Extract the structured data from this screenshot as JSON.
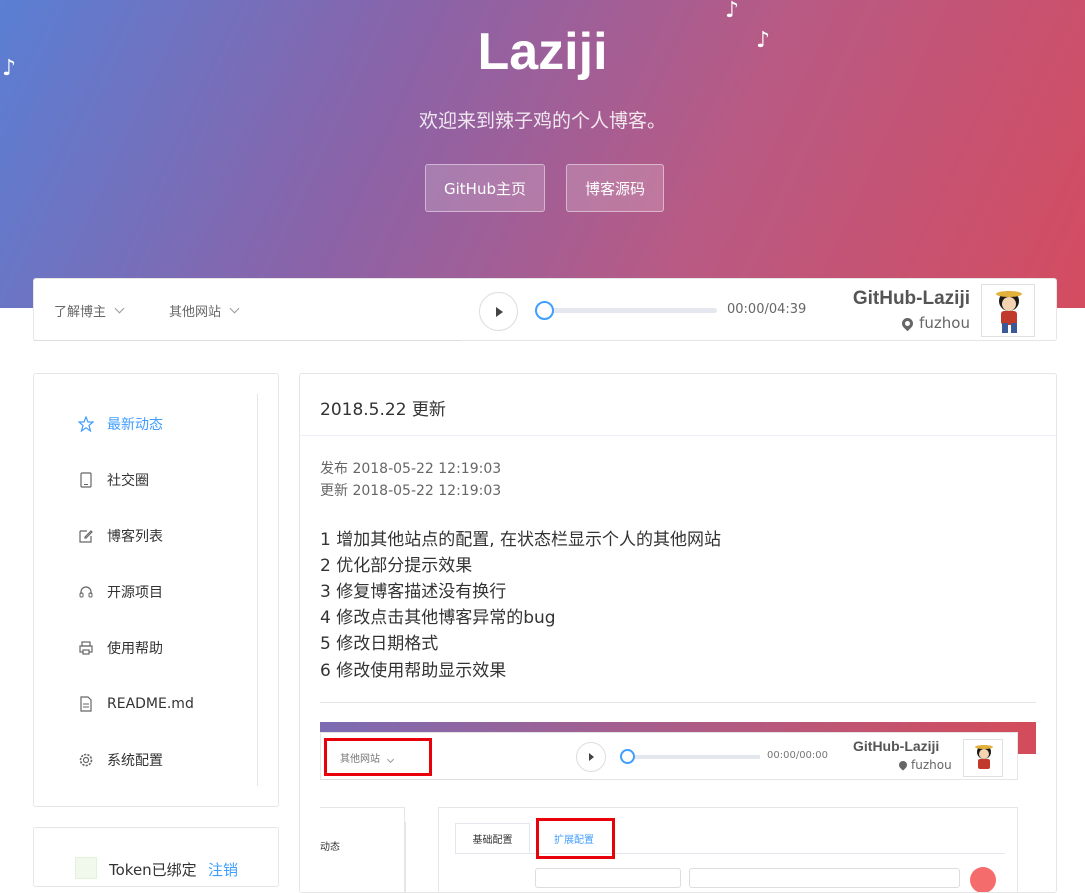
{
  "hero": {
    "title": "Laziji",
    "subtitle": "欢迎来到辣子鸡的个人博客。",
    "buttons": [
      "GitHub主页",
      "博客源码"
    ],
    "note_glyph": "♪"
  },
  "topbar": {
    "menus": [
      "了解博主",
      "其他网站"
    ],
    "player_time": "00:00/04:39",
    "player_progress": 0,
    "github_name": "GitHub-Laziji",
    "location": "fuzhou"
  },
  "sidebar": {
    "items": [
      {
        "label": "最新动态",
        "icon": "star-icon",
        "active": true
      },
      {
        "label": "社交圈",
        "icon": "tablet-icon",
        "active": false
      },
      {
        "label": "博客列表",
        "icon": "edit-icon",
        "active": false
      },
      {
        "label": "开源项目",
        "icon": "headset-icon",
        "active": false
      },
      {
        "label": "使用帮助",
        "icon": "printer-icon",
        "active": false
      },
      {
        "label": "README.md",
        "icon": "document-icon",
        "active": false
      },
      {
        "label": "系统配置",
        "icon": "gear-icon",
        "active": false
      }
    ],
    "token_label": "Token已绑定",
    "token_action": "注销"
  },
  "post": {
    "title": "2018.5.22 更新",
    "published": "发布 2018-05-22 12:19:03",
    "updated": "更新 2018-05-22 12:19:03",
    "lines": [
      "1 增加其他站点的配置, 在状态栏显示个人的其他网站",
      "2 优化部分提示效果",
      "3 修复博客描述没有换行",
      "4 修改点击其他博客异常的bug",
      "5 修改日期格式",
      "6 修改使用帮助显示效果"
    ]
  },
  "embedded_screenshot": {
    "menu": "其他网站",
    "player_time": "00:00/00:00",
    "github_name": "GitHub-Laziji",
    "location": "fuzhou",
    "side_text": "动态",
    "tabs": [
      "基础配置",
      "扩展配置"
    ],
    "highlight_color": "#e8000b"
  },
  "colors": {
    "accent": "#409eff",
    "hero_left": "#5a7fd4",
    "hero_right": "#d44c60"
  }
}
